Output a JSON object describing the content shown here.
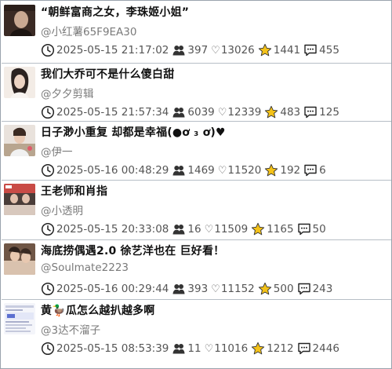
{
  "posts": [
    {
      "title": "“朝鲜富商之女，李珠姬小姐”",
      "author": "@小红薯65F9EA30",
      "time": "2025-05-15 21:17:02",
      "views": "397",
      "likes": "13026",
      "favorites": "1441",
      "comments": "455",
      "thumb_colors": [
        "#3a2a24",
        "#c9a892"
      ]
    },
    {
      "title": "我们大乔可不是什么傻白甜",
      "author": "@夕夕剪辑",
      "time": "2025-05-15 21:57:34",
      "views": "6039",
      "likes": "12339",
      "favorites": "483",
      "comments": "125",
      "thumb_colors": [
        "#f3ece6",
        "#2b2220"
      ]
    },
    {
      "title": "日子渺小重复 却都是幸福(●ơ ₃ ơ)♥",
      "author": "@伊一",
      "time": "2025-05-16 00:48:29",
      "views": "1469",
      "likes": "11520",
      "favorites": "192",
      "comments": "6",
      "thumb_colors": [
        "#e9e2dc",
        "#b8a58f"
      ]
    },
    {
      "title": "王老师和肖指",
      "author": "@小透明",
      "time": "2025-05-15 20:33:08",
      "views": "16",
      "likes": "11509",
      "favorites": "1165",
      "comments": "50",
      "thumb_colors": [
        "#4a3d39",
        "#c94b46"
      ]
    },
    {
      "title": "海底捞偶遇2.0 徐艺洋也在 巨好看！",
      "author": "@Soulmate2223",
      "time": "2025-05-16 00:29:44",
      "views": "393",
      "likes": "11152",
      "favorites": "500",
      "comments": "243",
      "thumb_colors": [
        "#6f5646",
        "#d9c2ae"
      ]
    },
    {
      "title": "黄🦆瓜怎么越扒越多啊",
      "author": "@3达不溜子",
      "time": "2025-05-15 08:53:39",
      "views": "11",
      "likes": "11016",
      "favorites": "1212",
      "comments": "2446",
      "thumb_colors": [
        "#f4f5fa",
        "#5b6fd0"
      ]
    }
  ]
}
